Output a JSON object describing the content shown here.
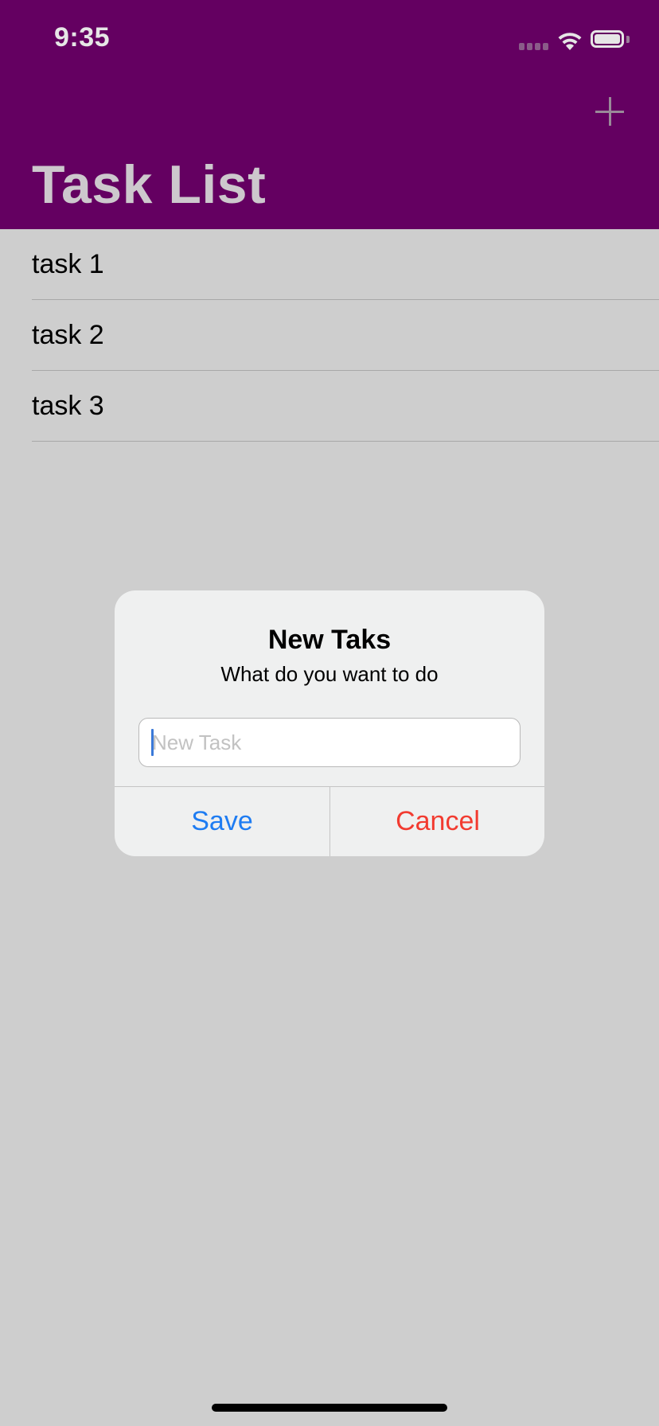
{
  "status_bar": {
    "time": "9:35"
  },
  "nav": {
    "title": "Task List",
    "add_icon": "plus-icon"
  },
  "tasks": [
    {
      "label": "task 1"
    },
    {
      "label": "task 2"
    },
    {
      "label": "task 3"
    }
  ],
  "alert": {
    "title": "New Taks",
    "message": "What do you want to do",
    "input_placeholder": "New Task",
    "input_value": "",
    "save_label": "Save",
    "cancel_label": "Cancel"
  },
  "colors": {
    "nav_background": "#640061",
    "save": "#1e7cf2",
    "cancel": "#f23b30",
    "overlay_background": "#cecece"
  }
}
